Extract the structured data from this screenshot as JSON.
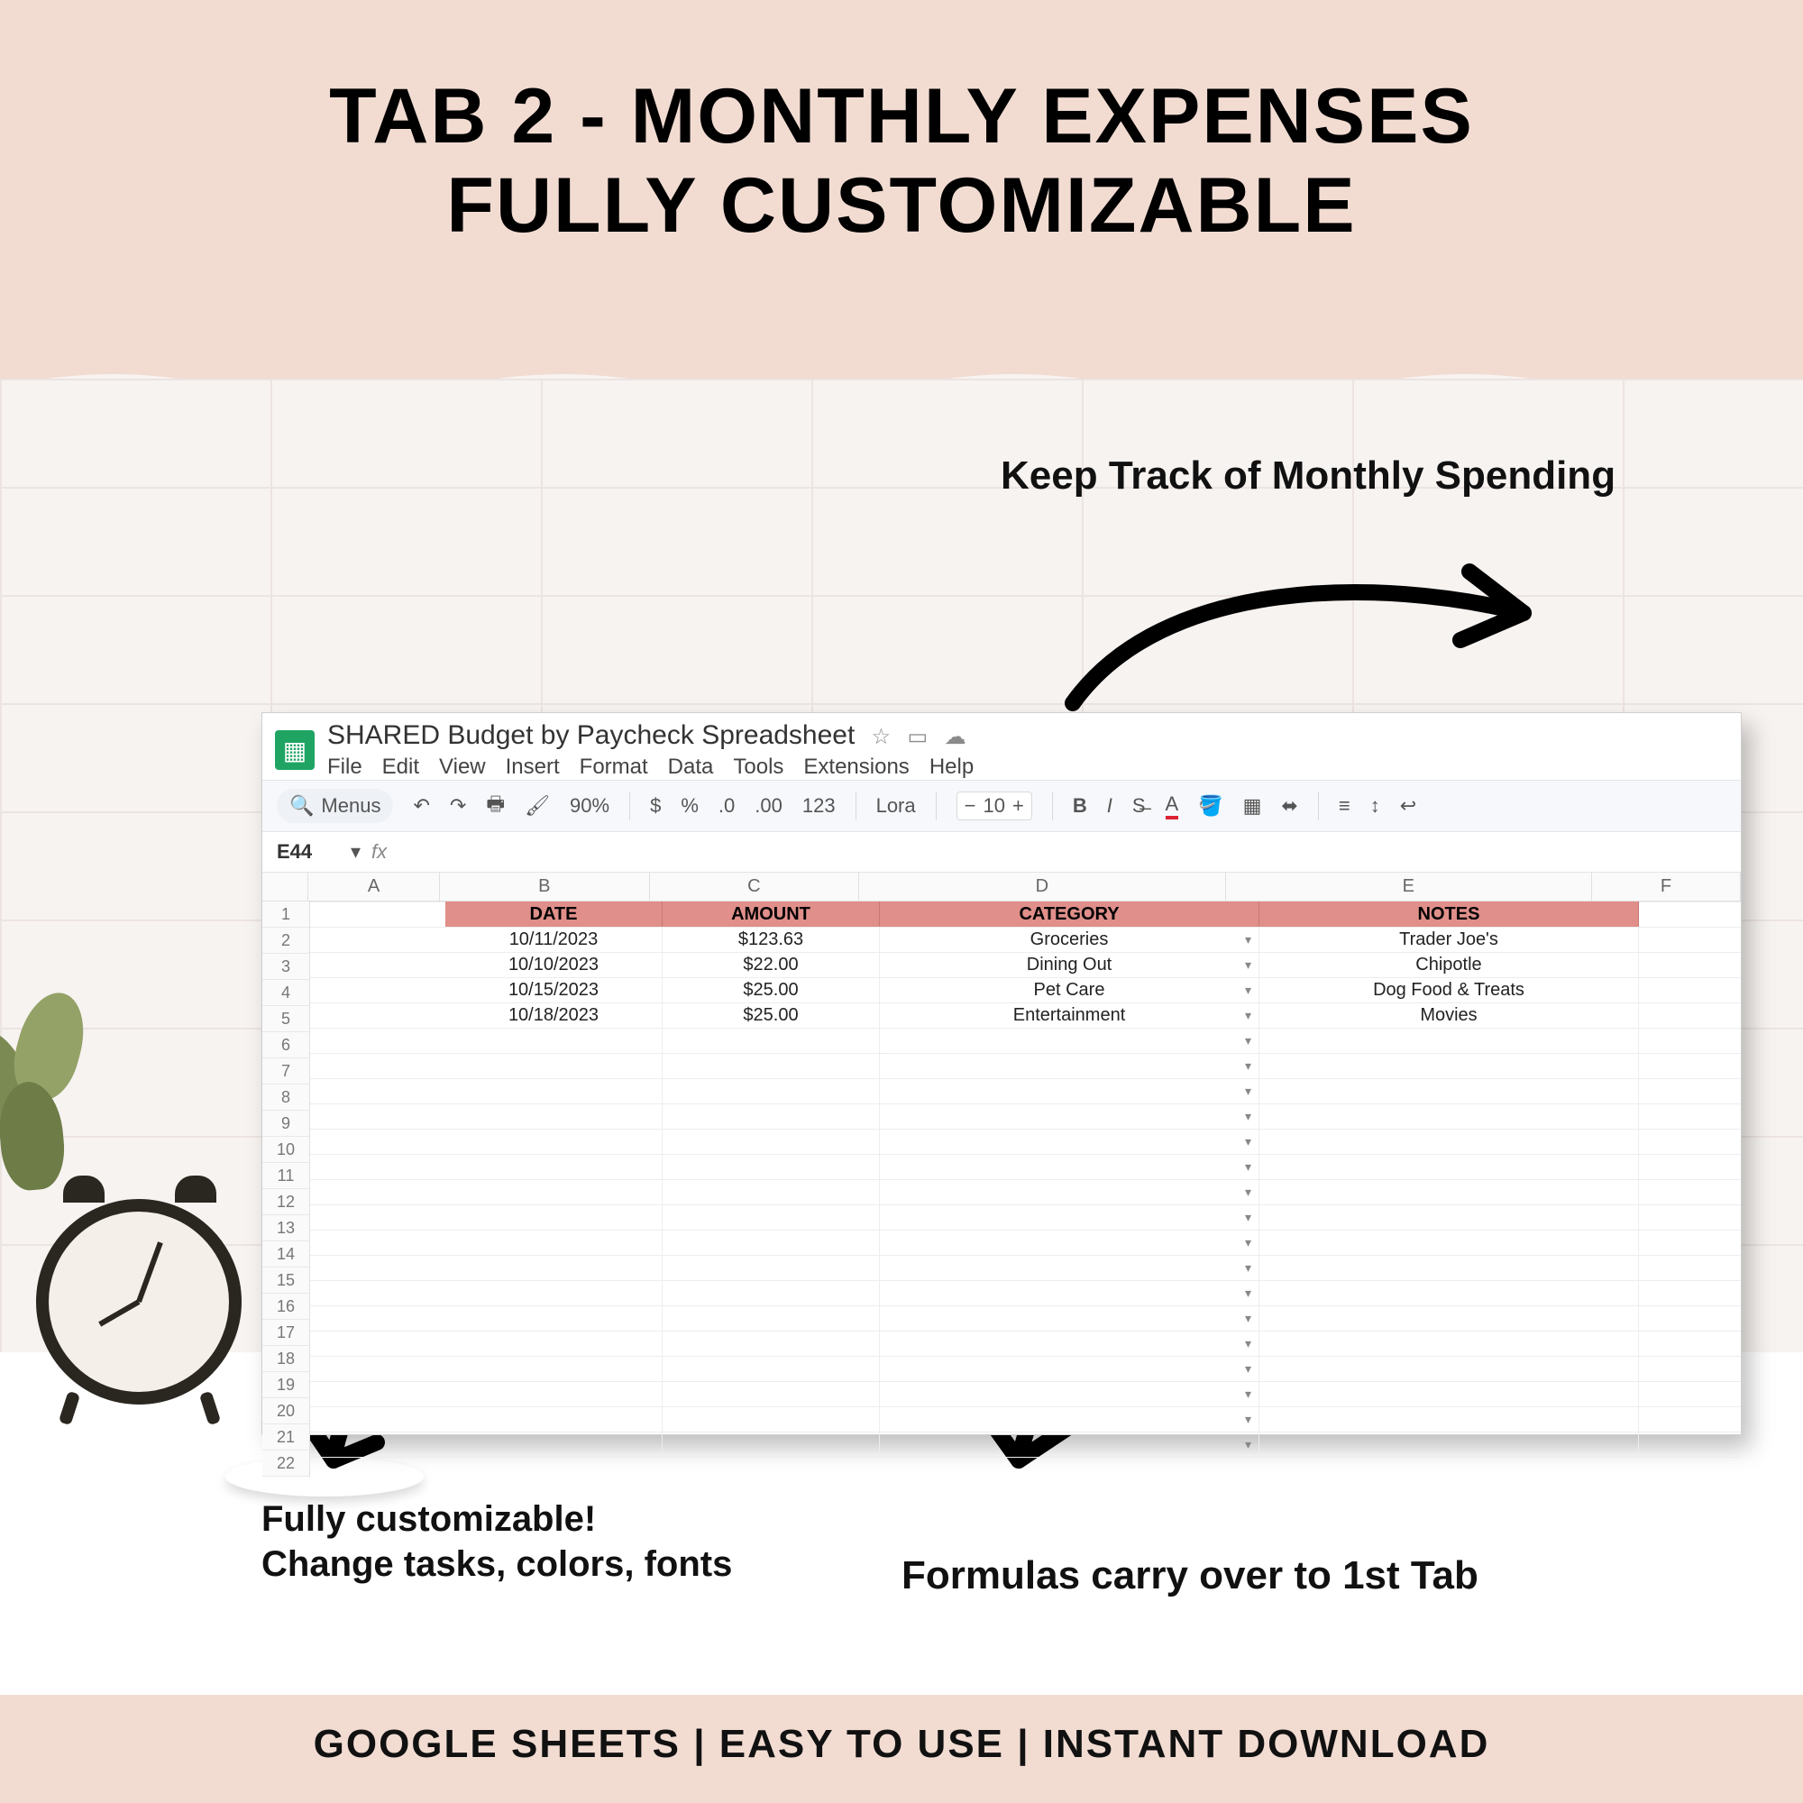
{
  "header": {
    "line1": "TAB 2 - MONTHLY EXPENSES",
    "line2": "FULLY CUSTOMIZABLE"
  },
  "annotations": {
    "top": "Keep Track of Monthly Spending",
    "left_line1": "Fully customizable!",
    "left_line2": "Change tasks, colors, fonts",
    "bottom": "Formulas carry over to 1st Tab"
  },
  "footer": "GOOGLE SHEETS | EASY TO USE | INSTANT DOWNLOAD",
  "sheet": {
    "doc_title": "SHARED Budget by Paycheck Spreadsheet",
    "menus": [
      "File",
      "Edit",
      "View",
      "Insert",
      "Format",
      "Data",
      "Tools",
      "Extensions",
      "Help"
    ],
    "toolbar": {
      "menus_label": "Menus",
      "zoom": "90%",
      "font": "Lora",
      "font_size": "10"
    },
    "active_cell": "E44",
    "columns": [
      "A",
      "B",
      "C",
      "D",
      "E",
      "F"
    ],
    "table_headers": {
      "B": "DATE",
      "C": "AMOUNT",
      "D": "CATEGORY",
      "E": "NOTES"
    },
    "rows": [
      {
        "date": "10/11/2023",
        "amount": "$123.63",
        "category": "Groceries",
        "notes": "Trader Joe's"
      },
      {
        "date": "10/10/2023",
        "amount": "$22.00",
        "category": "Dining Out",
        "notes": "Chipotle"
      },
      {
        "date": "10/15/2023",
        "amount": "$25.00",
        "category": "Pet Care",
        "notes": "Dog Food & Treats"
      },
      {
        "date": "10/18/2023",
        "amount": "$25.00",
        "category": "Entertainment",
        "notes": "Movies"
      }
    ],
    "row_numbers": 22
  }
}
